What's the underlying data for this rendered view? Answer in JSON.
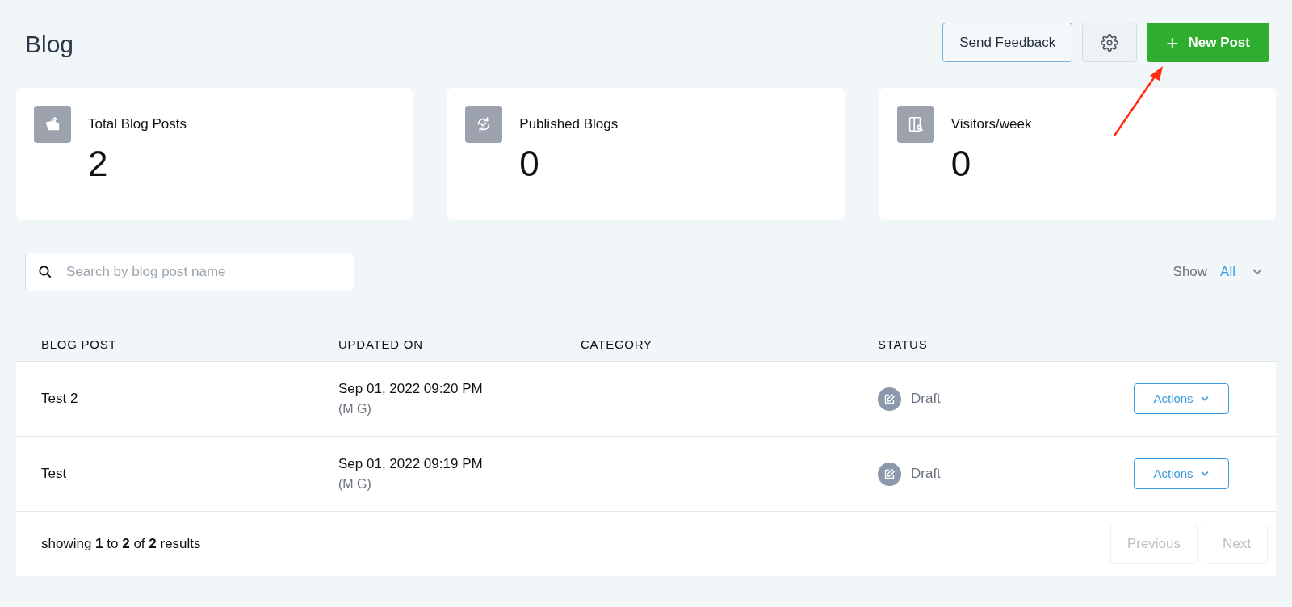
{
  "page": {
    "title": "Blog"
  },
  "header_buttons": [
    {
      "kind": "outline",
      "label": "Send Feedback"
    },
    {
      "kind": "icon"
    },
    {
      "kind": "primary",
      "label": "New Post",
      "icon": "+"
    }
  ],
  "annotation": {
    "kind": "arrow",
    "color": "#ff2a10"
  },
  "stats": [
    {
      "kind": "posts",
      "label": "Total Blog Posts",
      "value": "2"
    },
    {
      "kind": "published",
      "label": "Published Blogs",
      "value": "0"
    },
    {
      "kind": "visitors",
      "label": "Visitors/week",
      "value": "0"
    }
  ],
  "search": {
    "placeholder": "Search by blog post name"
  },
  "filter": {
    "label": "Show",
    "value": "All"
  },
  "table": {
    "columns": [
      "BLOG POST",
      "UPDATED ON",
      "CATEGORY",
      "STATUS"
    ],
    "rows": [
      {
        "name": "Test 2",
        "updated": "Sep 01, 2022 09:20 PM",
        "author": "(M G)",
        "category": "",
        "status": "Draft",
        "action": "Actions"
      },
      {
        "name": "Test",
        "updated": "Sep 01, 2022 09:19 PM",
        "author": "(M G)",
        "category": "",
        "status": "Draft",
        "action": "Actions"
      }
    ]
  },
  "footer": {
    "summary": "showing **1** to **2** of **2** results",
    "buttons": [
      {
        "label": "Previous",
        "disabled": true
      },
      {
        "label": "Next",
        "disabled": true
      }
    ]
  }
}
